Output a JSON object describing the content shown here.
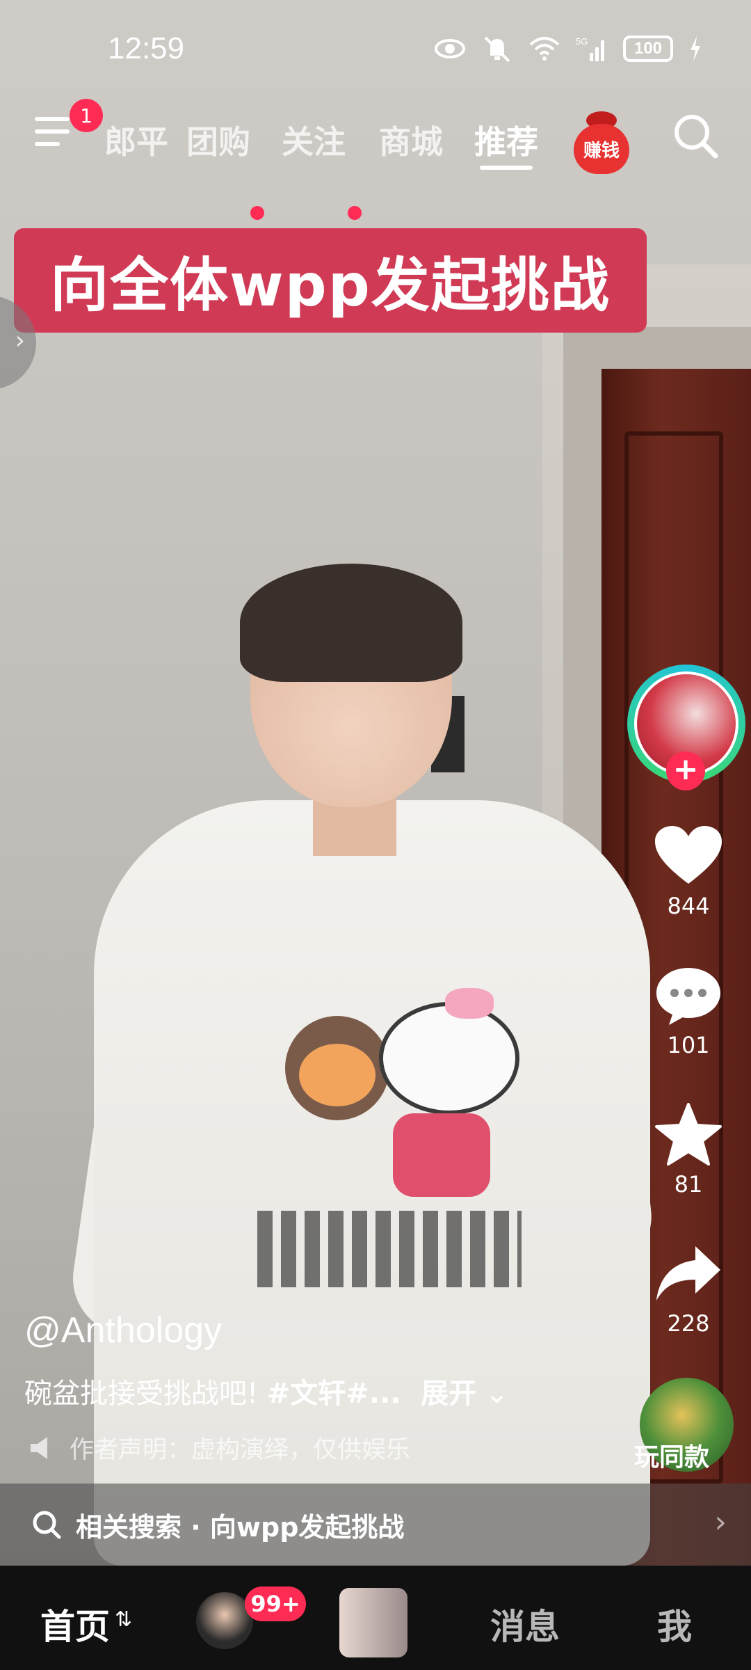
{
  "status_bar": {
    "time": "12:59",
    "battery": "100",
    "network": "5G"
  },
  "top_nav": {
    "menu_badge": "1",
    "tabs": [
      {
        "label": "郎平",
        "active": false,
        "dot": false
      },
      {
        "label": "团购",
        "active": false,
        "dot": true
      },
      {
        "label": "关注",
        "active": false,
        "dot": true
      },
      {
        "label": "商城",
        "active": false,
        "dot": false
      },
      {
        "label": "推荐",
        "active": true,
        "dot": false
      }
    ],
    "earn_label": "赚钱"
  },
  "video": {
    "banner": "向全体wpp发起挑战"
  },
  "actions": {
    "likes": "844",
    "comments": "101",
    "favorites": "81",
    "shares": "228",
    "same_style": "玩同款"
  },
  "info": {
    "author": "@Anthology",
    "caption_text": "碗盆批接受挑战吧! ",
    "caption_tags": "#文轩#...",
    "expand": "展开",
    "disclaimer": "作者声明：虚构演绎，仅供娱乐"
  },
  "related_search": {
    "label": "相关搜索 · 向wpp发起挑战"
  },
  "bottom_nav": {
    "home": "首页",
    "friends_badge": "99+",
    "messages": "消息",
    "me": "我"
  },
  "colors": {
    "accent": "#fe2c55",
    "banner": "#d03a55"
  }
}
